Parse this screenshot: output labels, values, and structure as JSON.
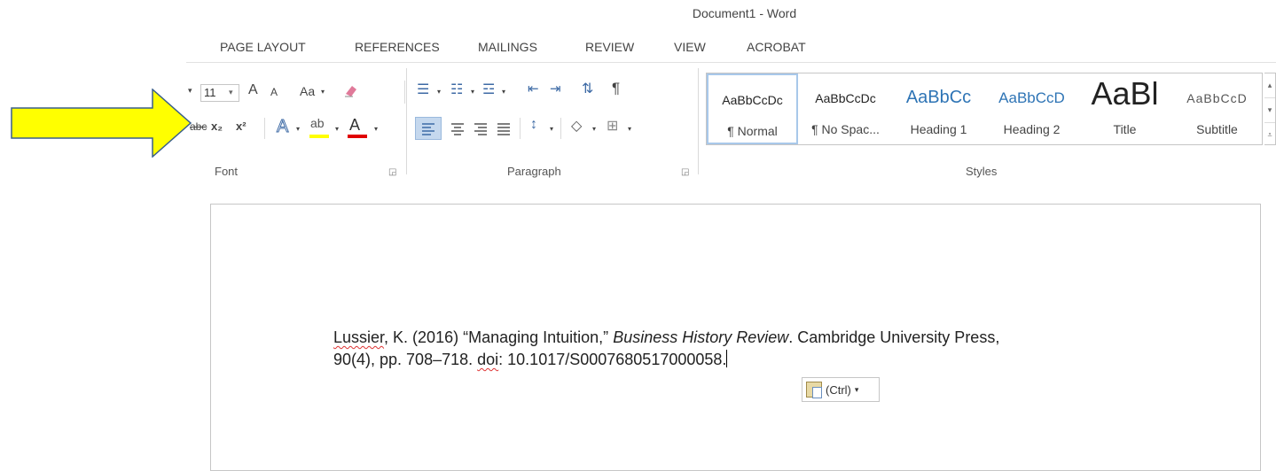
{
  "window": {
    "title": "Document1 - Word"
  },
  "tabs": [
    "PAGE LAYOUT",
    "REFERENCES",
    "MAILINGS",
    "REVIEW",
    "VIEW",
    "ACROBAT"
  ],
  "font_group": {
    "label": "Font",
    "font_size": "11",
    "grow_label": "A",
    "shrink_label": "A",
    "case_label": "Aa",
    "strike_label": "abc",
    "subscript_label": "x₂",
    "superscript_label": "x²",
    "text_effects_label": "A",
    "highlight_label": "ab",
    "font_color_label": "A",
    "highlight_color": "#ffff00",
    "font_color": "#e00000"
  },
  "paragraph_group": {
    "label": "Paragraph",
    "pilcrow": "¶"
  },
  "styles_group": {
    "label": "Styles",
    "tiles": [
      {
        "preview": "AaBbCcDc",
        "name": "¶ Normal"
      },
      {
        "preview": "AaBbCcDc",
        "name": "¶ No Spac..."
      },
      {
        "preview": "AaBbCc",
        "name": "Heading 1"
      },
      {
        "preview": "AaBbCcD",
        "name": "Heading 2"
      },
      {
        "preview": "AaBl",
        "name": "Title"
      },
      {
        "preview": "AaBbCcD",
        "name": "Subtitle"
      }
    ]
  },
  "document": {
    "line1_author": "Lussier",
    "line1_rest": ", K. (2016) “Managing Intuition,” ",
    "line1_journal": "Business History Review",
    "line1_tail": ". Cambridge University Press,",
    "line2_start": "90(4), pp. 708–718. ",
    "line2_doi_word": "doi",
    "line2_rest": ": 10.1017/S0007680517000058."
  },
  "paste_options": {
    "label": "(Ctrl)"
  },
  "arrow": {
    "fill": "#ffff00",
    "stroke": "#3a5f8a"
  }
}
